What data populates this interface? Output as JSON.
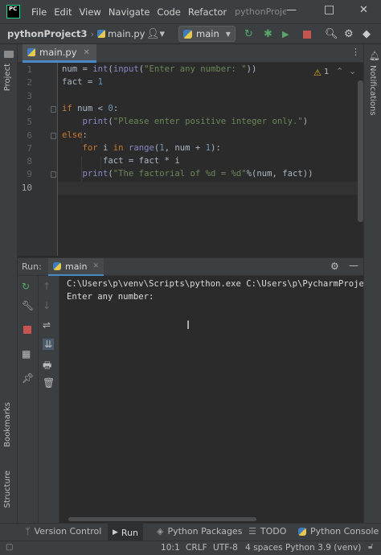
{
  "titlebar": {
    "logo": "PC",
    "menu": [
      "File",
      "Edit",
      "View",
      "Navigate",
      "Code",
      "Refactor"
    ],
    "title": "pythonProjec",
    "window_buttons": [
      "—",
      "□",
      "✕"
    ]
  },
  "navbar": {
    "project": "pythonProject3",
    "file": "main.py",
    "run_config": "main"
  },
  "left_stripe": {
    "project_label": "Project",
    "bookmarks_label": "Bookmarks",
    "structure_label": "Structure"
  },
  "right_stripe": {
    "notifications_label": "Notifications"
  },
  "tabs": [
    {
      "label": "main.py"
    }
  ],
  "editor": {
    "line_numbers": [
      "1",
      "2",
      "3",
      "4",
      "5",
      "6",
      "7",
      "8",
      "9",
      "10"
    ],
    "warnings_count": "1",
    "lines": [
      [
        {
          "t": "num = ",
          "c": ""
        },
        {
          "t": "int",
          "c": "bi"
        },
        {
          "t": "(",
          "c": ""
        },
        {
          "t": "input",
          "c": "bi"
        },
        {
          "t": "(",
          "c": ""
        },
        {
          "t": "\"Enter any number: \"",
          "c": "str"
        },
        {
          "t": "))",
          "c": ""
        }
      ],
      [
        {
          "t": "fact = ",
          "c": ""
        },
        {
          "t": "1",
          "c": "num"
        }
      ],
      [],
      [
        {
          "t": "if",
          "c": "kw"
        },
        {
          "t": " num < ",
          "c": ""
        },
        {
          "t": "0",
          "c": "num"
        },
        {
          "t": ":",
          "c": ""
        }
      ],
      [
        {
          "t": "    ",
          "c": ""
        },
        {
          "t": "print",
          "c": "bi"
        },
        {
          "t": "(",
          "c": ""
        },
        {
          "t": "\"Please enter positive integer only.\"",
          "c": "str"
        },
        {
          "t": ")",
          "c": ""
        }
      ],
      [
        {
          "t": "else",
          "c": "kw"
        },
        {
          "t": ":",
          "c": ""
        }
      ],
      [
        {
          "t": "    ",
          "c": ""
        },
        {
          "t": "for",
          "c": "kw"
        },
        {
          "t": " i ",
          "c": ""
        },
        {
          "t": "in",
          "c": "kw"
        },
        {
          "t": " ",
          "c": ""
        },
        {
          "t": "range",
          "c": "bi"
        },
        {
          "t": "(",
          "c": ""
        },
        {
          "t": "1",
          "c": "num"
        },
        {
          "t": ", num + ",
          "c": ""
        },
        {
          "t": "1",
          "c": "num"
        },
        {
          "t": "):",
          "c": ""
        }
      ],
      [
        {
          "t": "        fact = fact * i",
          "c": ""
        }
      ],
      [
        {
          "t": "    ",
          "c": ""
        },
        {
          "t": "print",
          "c": "bi"
        },
        {
          "t": "(",
          "c": ""
        },
        {
          "t": "\"The factorial of %d = %d\"",
          "c": "str"
        },
        {
          "t": "%(num, fact))",
          "c": ""
        }
      ],
      []
    ]
  },
  "run_panel": {
    "label": "Run:",
    "tab": "main",
    "console_lines": [
      "C:\\Users\\p\\venv\\Scripts\\python.exe C:\\Users\\p\\PycharmProje",
      "Enter any number:"
    ]
  },
  "bottom_tools": [
    "Version Control",
    "Run",
    "Python Packages",
    "TODO",
    "Python Console"
  ],
  "status": {
    "position": "10:1",
    "line_sep": "CRLF",
    "encoding": "UTF-8",
    "indent": "4 spaces",
    "interpreter": "Python 3.9 (venv)"
  },
  "colors": {
    "keyword": "#cc7832",
    "builtin": "#8888c6",
    "string": "#6a8759",
    "number": "#6897bb",
    "run_green": "#59a869",
    "stop_red": "#c75450"
  }
}
